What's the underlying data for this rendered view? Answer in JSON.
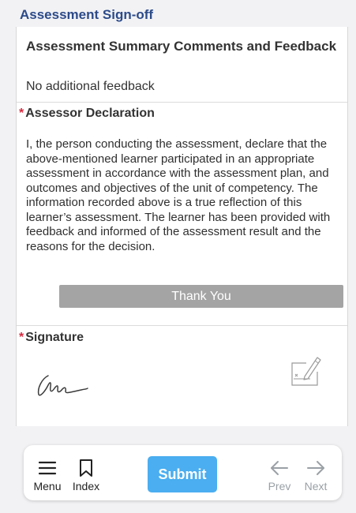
{
  "section": {
    "title": "Assessment Sign-off"
  },
  "summary": {
    "title": "Assessment Summary Comments and Feedback",
    "text": "No additional feedback"
  },
  "declaration": {
    "required_marker": "*",
    "title": "Assessor Declaration",
    "text": "I, the person conducting the assessment, declare that the above-mentioned learner participated in an appropriate assessment in accordance with the assessment plan, and outcomes and objectives of the unit of competency. The information recorded above is a true reflection of this learner’s assessment. The learner has been provided with feedback and informed of the assessment result and the reasons for the decision.",
    "button_label": "Thank You"
  },
  "signature": {
    "required_marker": "*",
    "title": "Signature",
    "edit_icon": "signature-edit-icon"
  },
  "bottom_bar": {
    "menu": {
      "label": "Menu",
      "icon": "hamburger-menu-icon"
    },
    "index": {
      "label": "Index",
      "icon": "bookmark-icon"
    },
    "submit": {
      "label": "Submit"
    },
    "prev": {
      "label": "Prev",
      "icon": "arrow-left-icon",
      "enabled": false
    },
    "next": {
      "label": "Next",
      "icon": "arrow-right-icon",
      "enabled": false
    }
  },
  "colors": {
    "header_text": "#2c4b8a",
    "required": "#d9283c",
    "submit": "#4aaef0",
    "thank_you_button": "#a4a4a4",
    "disabled_nav": "#9aa0a6"
  }
}
